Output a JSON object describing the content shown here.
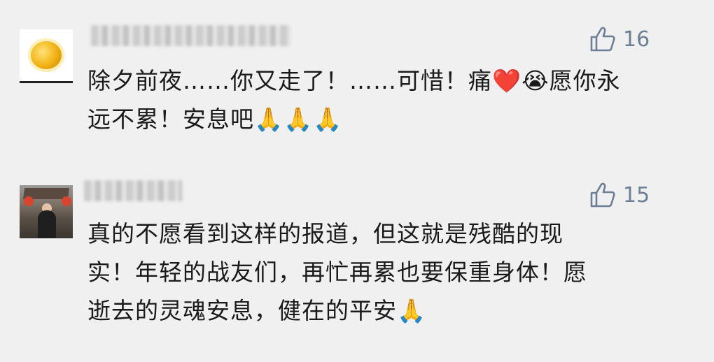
{
  "comments": [
    {
      "likes": "16",
      "text_lines": [
        "除夕前夜……你又走了！……可惜！痛❤️😭愿你永",
        "远不累！安息吧🙏🙏🙏"
      ]
    },
    {
      "likes": "15",
      "text_lines": [
        "真的不愿看到这样的报道，但这就是残酷的现",
        "实！年轻的战友们，再忙再累也要保重身体！愿",
        "逝去的灵魂安息，健在的平安🙏"
      ]
    }
  ],
  "colors": {
    "background": "#f0f0f0",
    "like_color": "#6c7f95",
    "text": "#1a1a1a"
  },
  "icons": {
    "like": "thumbs-up-icon"
  }
}
